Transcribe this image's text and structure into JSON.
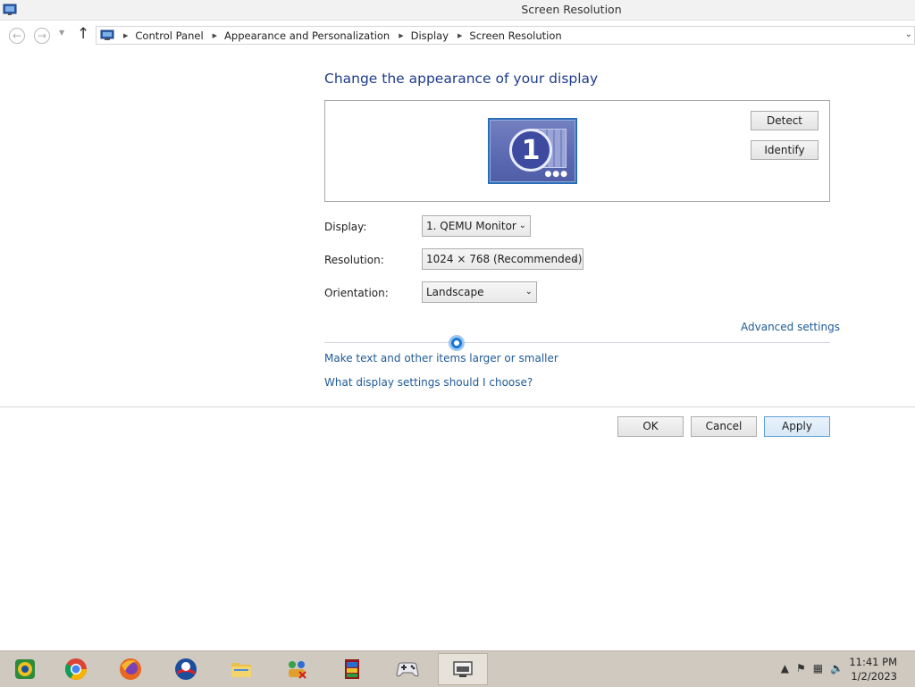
{
  "window": {
    "title": "Screen Resolution"
  },
  "breadcrumb": {
    "items": [
      "Control Panel",
      "Appearance and Personalization",
      "Display",
      "Screen Resolution"
    ]
  },
  "main": {
    "heading": "Change the appearance of your display",
    "monitor_number": "1",
    "detect_label": "Detect",
    "identify_label": "Identify",
    "display_label": "Display:",
    "display_value": "1. QEMU Monitor",
    "resolution_label": "Resolution:",
    "resolution_value": "1024 × 768 (Recommended)",
    "orientation_label": "Orientation:",
    "orientation_value": "Landscape",
    "advanced_link": "Advanced settings",
    "textsize_link": "Make text and other items larger or smaller",
    "help_link": "What display settings should I choose?"
  },
  "buttons": {
    "ok": "OK",
    "cancel": "Cancel",
    "apply": "Apply"
  },
  "taskbar": {
    "items": [
      "photo-app",
      "chrome",
      "firefox",
      "obama-app",
      "file-explorer",
      "network-app",
      "winrar",
      "game-controller",
      "screen-resolution"
    ],
    "clock_time": "11:41 PM",
    "clock_date": "1/2/2023"
  },
  "colors": {
    "heading": "#1e3c8c",
    "link": "#1e5a96",
    "taskbar": "#cfc9bf"
  }
}
